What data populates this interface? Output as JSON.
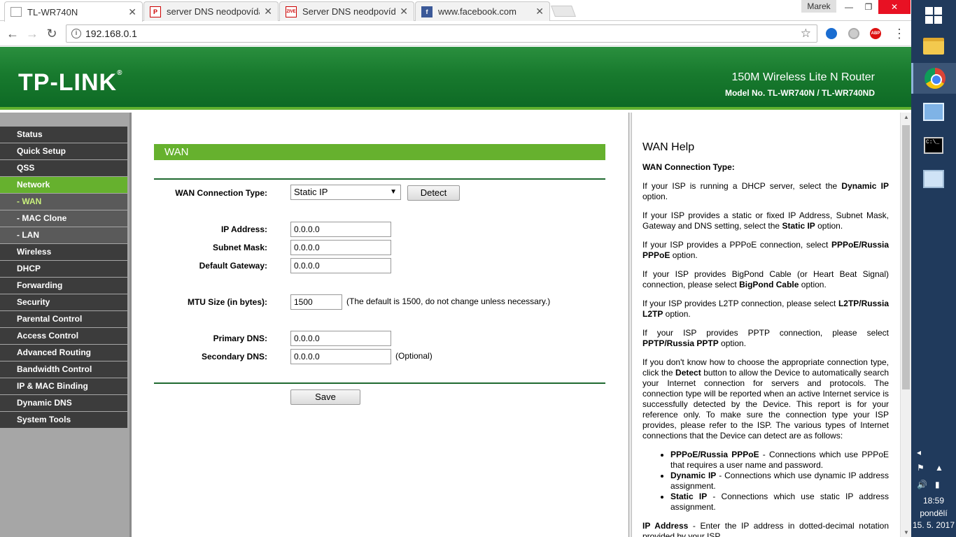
{
  "browser": {
    "tabs": [
      {
        "title": "TL-WR740N",
        "favicon": "blank-page-icon"
      },
      {
        "title": "server DNS neodpovídá -",
        "favicon": "pnet-icon"
      },
      {
        "title": "Server DNS neodpovídá -",
        "favicon": "zive-icon"
      },
      {
        "title": "www.facebook.com",
        "favicon": "facebook-icon"
      }
    ],
    "tab_close": "✕",
    "window_user": "Marek",
    "url": "192.168.0.1"
  },
  "header": {
    "logo": "TP-LINK",
    "product": "150M Wireless Lite N Router",
    "model": "Model No. TL-WR740N / TL-WR740ND"
  },
  "menu": [
    "Status",
    "Quick Setup",
    "QSS",
    "Network",
    "- WAN",
    "- MAC Clone",
    "- LAN",
    "Wireless",
    "DHCP",
    "Forwarding",
    "Security",
    "Parental Control",
    "Access Control",
    "Advanced Routing",
    "Bandwidth Control",
    "IP & MAC Binding",
    "Dynamic DNS",
    "System Tools"
  ],
  "wan": {
    "title": "WAN",
    "connection_type_label": "WAN Connection Type:",
    "connection_type_value": "Static IP",
    "detect_button": "Detect",
    "ip_label": "IP Address:",
    "ip_value": "0.0.0.0",
    "mask_label": "Subnet Mask:",
    "mask_value": "0.0.0.0",
    "gateway_label": "Default Gateway:",
    "gateway_value": "0.0.0.0",
    "mtu_label": "MTU Size (in bytes):",
    "mtu_value": "1500",
    "mtu_note": "(The default is 1500, do not change unless necessary.)",
    "dns1_label": "Primary DNS:",
    "dns1_value": "0.0.0.0",
    "dns2_label": "Secondary DNS:",
    "dns2_value": "0.0.0.0",
    "optional_note": "(Optional)",
    "save_button": "Save"
  },
  "help": {
    "title": "WAN Help",
    "subtitle": "WAN Connection Type:",
    "p1a": "If your ISP is running a DHCP server, select the ",
    "p1b": "Dynamic IP",
    "p1c": " option.",
    "p2a": "If your ISP provides a static or fixed IP Address, Subnet Mask, Gateway and DNS setting, select the ",
    "p2b": "Static IP",
    "p2c": " option.",
    "p3a": "If your ISP provides a PPPoE connection, select ",
    "p3b": "PPPoE/Russia PPPoE",
    "p3c": " option.",
    "p4a": "If your ISP provides BigPond Cable (or Heart Beat Signal) connection, please select ",
    "p4b": "BigPond Cable",
    "p4c": " option.",
    "p5a": "If your ISP provides L2TP connection, please select ",
    "p5b": "L2TP/Russia L2TP",
    "p5c": " option.",
    "p6a": "If your ISP provides PPTP connection, please select ",
    "p6b": "PPTP/Russia PPTP",
    "p6c": " option.",
    "p7a": "If you don't know how to choose the appropriate connection type, click the ",
    "p7b": "Detect",
    "p7c": " button to allow the Device to automatically search your Internet connection for servers and protocols. The connection type will be reported when an active Internet service is successfully detected by the Device. This report is for your reference only. To make sure the connection type your ISP provides, please refer to the ISP. The various types of Internet connections that the Device can detect are as follows:",
    "li1a": "PPPoE/Russia PPPoE",
    "li1b": " - Connections which use PPPoE that requires a user name and password.",
    "li2a": "Dynamic IP",
    "li2b": " - Connections which use dynamic IP address assignment.",
    "li3a": "Static IP",
    "li3b": " - Connections which use static IP address assignment.",
    "p8a": "IP Address",
    "p8b": " - Enter the IP address in dotted-decimal notation provided by your ISP."
  },
  "taskbar": {
    "cmd_text": "C:\\_",
    "time": "18:59",
    "day": "pondělí",
    "date": "15. 5. 2017"
  },
  "colors": {
    "accent_green": "#66b12e",
    "header_green": "#187a2e",
    "menu_dark": "#3c3c3c"
  }
}
